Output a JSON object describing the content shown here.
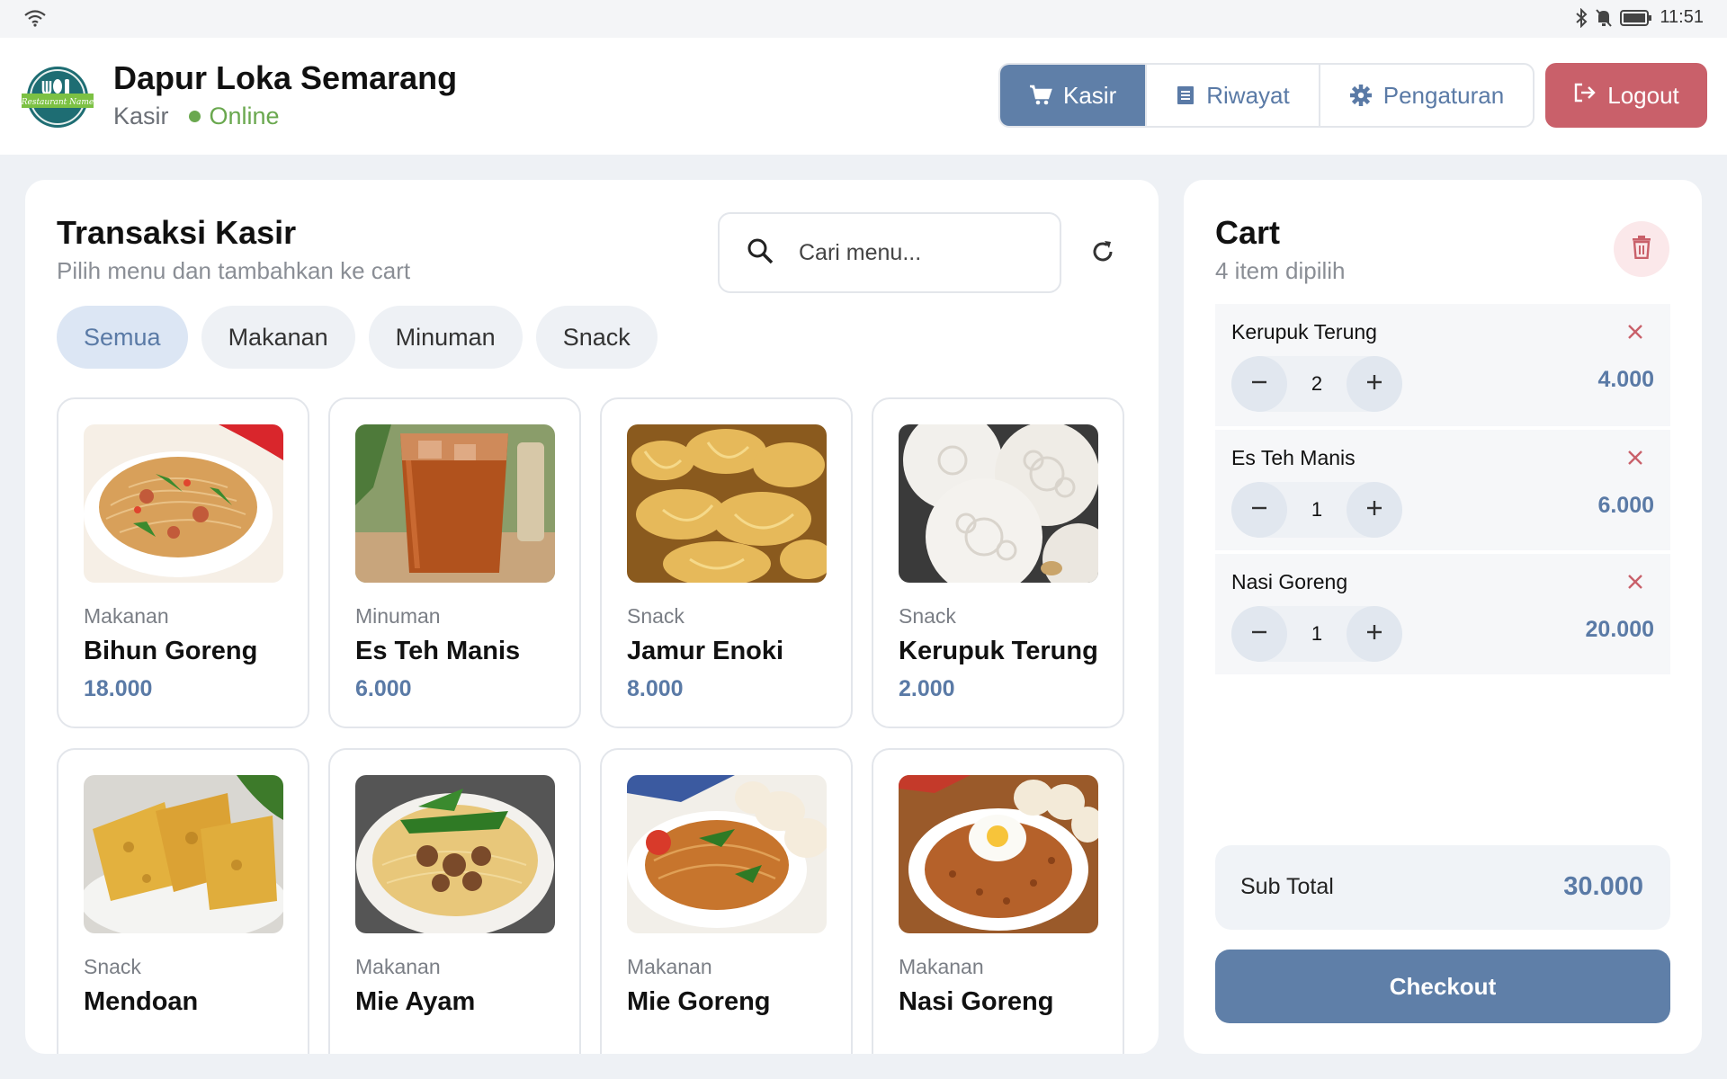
{
  "status_bar": {
    "time": "11:51",
    "icons": [
      "wifi-icon",
      "bluetooth-icon",
      "bell-off-icon",
      "battery-icon"
    ]
  },
  "header": {
    "logo_text": "Restaurant Name",
    "app_title": "Dapur Loka Semarang",
    "role": "Kasir",
    "status": "Online",
    "nav": [
      {
        "label": "Kasir",
        "icon": "cart-icon",
        "active": true
      },
      {
        "label": "Riwayat",
        "icon": "receipt-icon",
        "active": false
      },
      {
        "label": "Pengaturan",
        "icon": "gear-icon",
        "active": false
      }
    ],
    "logout_label": "Logout"
  },
  "main": {
    "title": "Transaksi Kasir",
    "subtitle": "Pilih menu dan tambahkan ke cart",
    "search_placeholder": "Cari menu...",
    "categories": [
      {
        "label": "Semua",
        "active": true
      },
      {
        "label": "Makanan",
        "active": false
      },
      {
        "label": "Minuman",
        "active": false
      },
      {
        "label": "Snack",
        "active": false
      }
    ],
    "menu_items": [
      {
        "category": "Makanan",
        "name": "Bihun Goreng",
        "price": "18.000",
        "image": "bihun-goreng-photo"
      },
      {
        "category": "Minuman",
        "name": "Es Teh Manis",
        "price": "6.000",
        "image": "es-teh-photo"
      },
      {
        "category": "Snack",
        "name": "Jamur Enoki",
        "price": "8.000",
        "image": "jamur-enoki-photo"
      },
      {
        "category": "Snack",
        "name": "Kerupuk Terung",
        "price": "2.000",
        "image": "kerupuk-photo"
      },
      {
        "category": "Snack",
        "name": "Mendoan",
        "price": "",
        "image": "mendoan-photo"
      },
      {
        "category": "Makanan",
        "name": "Mie Ayam",
        "price": "",
        "image": "mie-ayam-photo"
      },
      {
        "category": "Makanan",
        "name": "Mie Goreng",
        "price": "",
        "image": "mie-goreng-photo"
      },
      {
        "category": "Makanan",
        "name": "Nasi Goreng",
        "price": "",
        "image": "nasi-goreng-photo"
      }
    ]
  },
  "cart": {
    "title": "Cart",
    "count_text": "4 item dipilih",
    "items": [
      {
        "name": "Kerupuk Terung",
        "qty": "2",
        "price": "4.000"
      },
      {
        "name": "Es Teh Manis",
        "qty": "1",
        "price": "6.000"
      },
      {
        "name": "Nasi Goreng",
        "qty": "1",
        "price": "20.000"
      }
    ],
    "subtotal_label": "Sub Total",
    "subtotal_value": "30.000",
    "checkout_label": "Checkout"
  },
  "colors": {
    "accent": "#5f7fa8",
    "danger": "#c9606a",
    "online": "#6aa84f"
  }
}
